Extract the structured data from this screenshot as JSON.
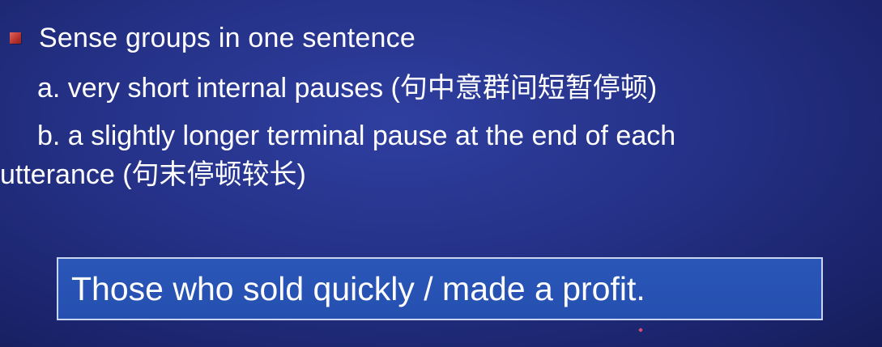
{
  "slide": {
    "heading": "Sense groups in one sentence",
    "point_a": "a. very short internal pauses (句中意群间短暂停顿)",
    "point_b_line1": "b. a slightly longer terminal pause at the end of each",
    "point_b_line2": "utterance (句末停顿较长)",
    "example": "Those who sold quickly / made a profit."
  },
  "colors": {
    "background": "#26338a",
    "bullet": "#c0392b",
    "example_box": "#2752b4",
    "text": "#ffffff"
  }
}
